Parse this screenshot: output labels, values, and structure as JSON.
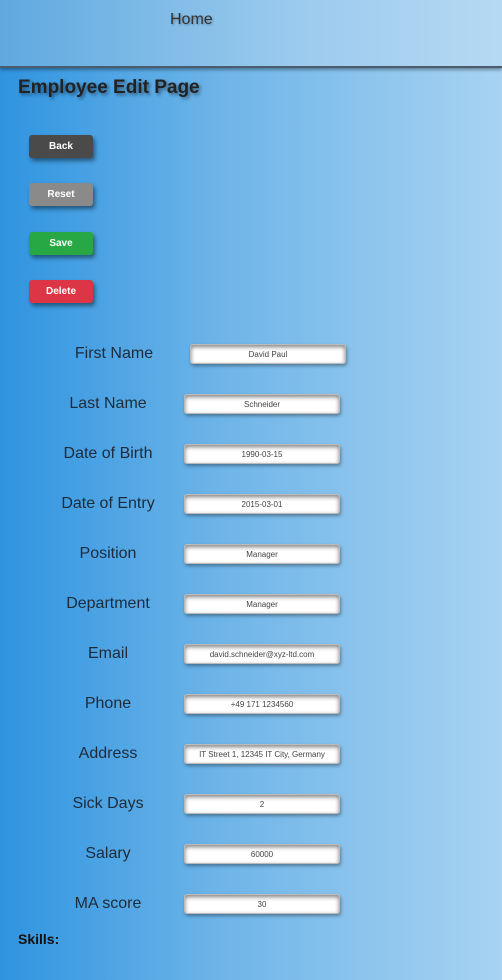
{
  "nav": {
    "home_label": "Home"
  },
  "page": {
    "title": "Employee Edit Page",
    "skills_label": "Skills:"
  },
  "buttons": {
    "back": "Back",
    "reset": "Reset",
    "save": "Save",
    "delete": "Delete"
  },
  "fields": {
    "first_name": {
      "label": "First Name",
      "value": "David Paul"
    },
    "last_name": {
      "label": "Last Name",
      "value": "Schneider"
    },
    "date_of_birth": {
      "label": "Date of Birth",
      "value": "1990-03-15"
    },
    "date_of_entry": {
      "label": "Date of Entry",
      "value": "2015-03-01"
    },
    "position": {
      "label": "Position",
      "value": "Manager"
    },
    "department": {
      "label": "Department",
      "value": "Manager"
    },
    "email": {
      "label": "Email",
      "value": "david.schneider@xyz-ltd.com"
    },
    "phone": {
      "label": "Phone",
      "value": "+49 171 1234560"
    },
    "address": {
      "label": "Address",
      "value": "IT Street 1, 12345 IT City, Germany"
    },
    "sick_days": {
      "label": "Sick Days",
      "value": "2"
    },
    "salary": {
      "label": "Salary",
      "value": "60000"
    },
    "ma_score": {
      "label": "MA score",
      "value": "30"
    }
  },
  "colors": {
    "back": "#4a4a4a",
    "reset": "#8a8a8a",
    "save": "#27a844",
    "delete": "#dc3545"
  }
}
